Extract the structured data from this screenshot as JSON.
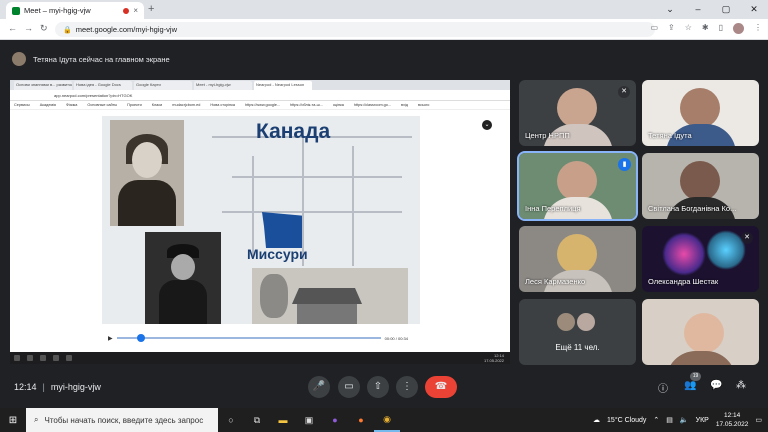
{
  "browser": {
    "tab_title": "Meet – myi-hgig-vjw",
    "tab_close": "×",
    "new_tab": "+",
    "url": "meet.google.com/myi-hgig-vjw",
    "window_controls": [
      "⌄",
      "–",
      "▢",
      "✕"
    ]
  },
  "meet": {
    "presenter_notice": "Тетяна Ідута сейчас на главном экране",
    "meeting_code": "myi-hgig-vjw",
    "time": "12:14",
    "participants_badge": "19"
  },
  "shared_screen": {
    "tabs": [
      "Основи знаннями в... развиток с...",
      "Нова ідея - Google Docs",
      "Google Карти",
      "Meet - myi-hgig-vjw",
      "Nearpod - Nearpod Lesson"
    ],
    "url": "app.nearpod.com/presentation?pin=HTGOK",
    "bookmarks": [
      "Сервисы",
      "Академія",
      "Фізика",
      "Основные сайты",
      "Проекти",
      "Класи",
      "mudacrjcbom.ed",
      "Нова сторінка",
      "https://www.google...",
      "https://облік-та-ш...",
      "оцінка",
      "https://classroom.go...",
      "вхід",
      "всього"
    ],
    "slide": {
      "title_canada": "Канада",
      "title_missouri": "Миссури"
    },
    "player_time": "00:00 / 00:34",
    "taskbar_time": "12:14",
    "taskbar_date": "17.05.2022"
  },
  "participants": [
    {
      "name": "Центр НРПП",
      "muted": true
    },
    {
      "name": "Тетяна Ідута",
      "muted": false
    },
    {
      "name": "Інна Переплиця",
      "muted": false,
      "speaking": true
    },
    {
      "name": "Світлана Богданівна Ко...",
      "muted": false
    },
    {
      "name": "Леся Кармазенко",
      "muted": false
    },
    {
      "name": "Олександра Шестак",
      "muted": true
    },
    {
      "name": "Ещё 11 чел."
    }
  ],
  "taskbar": {
    "search_placeholder": "Чтобы начать поиск, введите здесь запрос",
    "weather": "15°C Cloudy",
    "language": "УКР",
    "time": "12:14",
    "date": "17.05.2022"
  },
  "colors": {
    "meet_bg": "#202124",
    "end_call": "#ea4335",
    "missouri_fill": "#1a4f9c",
    "active_speaker": "#8ab4f8"
  }
}
